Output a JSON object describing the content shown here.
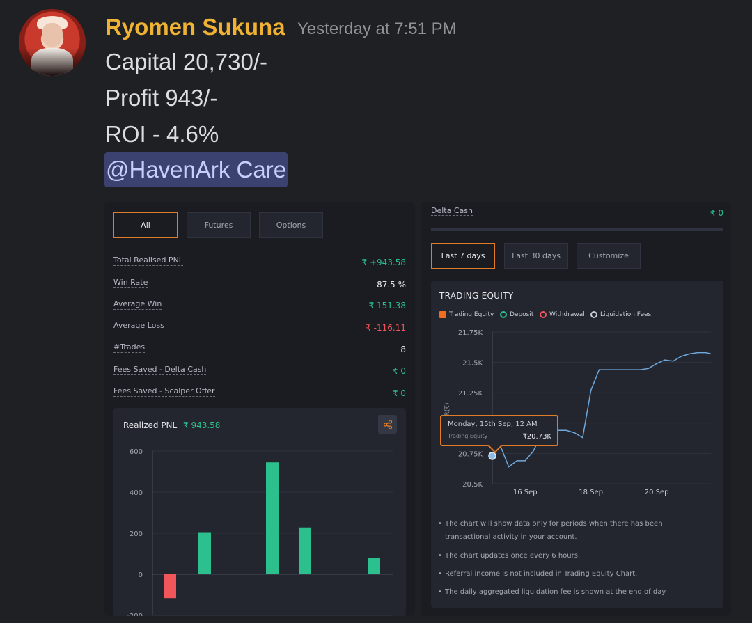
{
  "message": {
    "author": "Ryomen Sukuna",
    "timestamp": "Yesterday at 7:51 PM",
    "lines": [
      "Capital 20,730/-",
      "Profit 943/-",
      "ROI - 4.6%"
    ],
    "mention": "@HavenArk Care",
    "author_color": "#f0b232"
  },
  "left_panel": {
    "tabs": [
      "All",
      "Futures",
      "Options"
    ],
    "stats": [
      {
        "label": "Total Realised PNL",
        "value": "₹ +943.58"
      },
      {
        "label": "Win Rate",
        "value": "87.5 %"
      },
      {
        "label": "Average Win",
        "value": "₹ 151.38"
      },
      {
        "label": "Average Loss",
        "value": "₹ -116.11"
      },
      {
        "label": "#Trades",
        "value": "8"
      },
      {
        "label": "Fees Saved - Delta Cash",
        "value": "₹ 0"
      },
      {
        "label": "Fees Saved - Scalper Offer",
        "value": "₹ 0"
      }
    ],
    "pnl_card": {
      "title": "Realized PNL",
      "value": "₹ 943.58",
      "share_icon": "share-icon"
    }
  },
  "right_panel": {
    "delta_cash_label": "Delta Cash",
    "delta_cash_value": "₹ 0",
    "range_tabs": [
      "Last 7 days",
      "Last 30 days",
      "Customize"
    ],
    "equity_title": "TRADING EQUITY",
    "legend": [
      "Trading Equity",
      "Deposit",
      "Withdrawal",
      "Liquidation Fees"
    ],
    "y_axis_partial": "R(₹)",
    "tooltip": {
      "date": "Monday, 15th Sep, 12 AM",
      "label": "Trading Equity",
      "value": "₹20.73K"
    },
    "notes": [
      "The chart will show data only for periods when there has been transactional activity in your account.",
      "The chart updates once every 6 hours.",
      "Referral income is not included in Trading Equity Chart.",
      "The daily aggregated liquidation fee is shown at the end of day."
    ]
  },
  "colors": {
    "accent": "#e07b27",
    "positive": "#2cc08e",
    "negative": "#f2555a",
    "line": "#6fa8dc"
  },
  "chart_data": [
    {
      "type": "bar",
      "title": "Realized PNL",
      "yticks": [
        "600",
        "400",
        "200",
        "0",
        "-200"
      ],
      "ylim": [
        -200,
        600
      ],
      "values": [
        -116,
        205,
        545,
        228,
        80
      ],
      "grid": true
    },
    {
      "type": "line",
      "title": "TRADING EQUITY",
      "xticks": [
        "16 Sep",
        "18 Sep",
        "20 Sep"
      ],
      "yticks": [
        "21.75K",
        "21.5K",
        "21.25K",
        "21K",
        "20.75K",
        "20.5K"
      ],
      "ylim": [
        20500,
        21750
      ],
      "xlim": [
        15,
        21.65
      ],
      "series": [
        {
          "name": "Trading Equity",
          "x": [
            15,
            15.25,
            15.5,
            15.75,
            16,
            16.25,
            16.5,
            16.75,
            17,
            17.25,
            17.5,
            17.75,
            18,
            18.25,
            18.5,
            18.75,
            19,
            19.25,
            19.5,
            19.75,
            20,
            20.25,
            20.5,
            20.75,
            21,
            21.25,
            21.5,
            21.65
          ],
          "y": [
            20730,
            20810,
            20640,
            20690,
            20690,
            20770,
            20910,
            20930,
            20940,
            20940,
            20920,
            20880,
            21270,
            21440,
            21440,
            21440,
            21440,
            21440,
            21440,
            21450,
            21490,
            21520,
            21510,
            21550,
            21570,
            21580,
            21580,
            21570
          ]
        }
      ]
    }
  ]
}
